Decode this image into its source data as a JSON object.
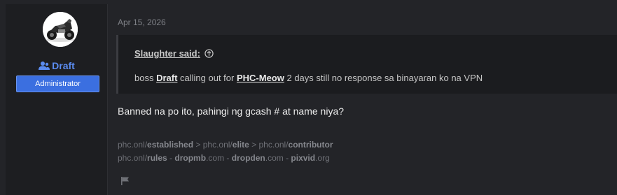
{
  "post": {
    "date": "Apr 15, 2026",
    "message": "Banned na po ito, pahingi ng gcash # at name niya?"
  },
  "author": {
    "name": "Draft",
    "role": "Administrator",
    "avatar_icon": "motorcycle-avatar",
    "accent_color": "#5b8cf0",
    "badge_color": "#3b6fe0"
  },
  "quote": {
    "author_said": "Slaughter said:",
    "jump_icon": "arrow-up-circle-icon",
    "text_before": "boss ",
    "mention_1": "Draft",
    "text_middle": " calling out for ",
    "mention_2": "PHC-Meow",
    "text_after": " 2 days still no response sa binayaran ko na VPN"
  },
  "signature": {
    "line1": [
      {
        "t": "phc.onl/",
        "b": false
      },
      {
        "t": "established",
        "b": true
      },
      {
        "t": " > phc.onl/",
        "b": false
      },
      {
        "t": "elite",
        "b": true
      },
      {
        "t": " > phc.onl/",
        "b": false
      },
      {
        "t": "contributor",
        "b": true
      }
    ],
    "line2": [
      {
        "t": "phc.onl/",
        "b": false
      },
      {
        "t": "rules",
        "b": true
      },
      {
        "t": " - ",
        "b": false
      },
      {
        "t": "dropmb",
        "b": true
      },
      {
        "t": ".com - ",
        "b": false
      },
      {
        "t": "dropden",
        "b": true
      },
      {
        "t": ".com - ",
        "b": false
      },
      {
        "t": "pixvid",
        "b": true
      },
      {
        "t": ".org",
        "b": false
      }
    ]
  },
  "actions": {
    "report_icon": "flag-icon"
  }
}
